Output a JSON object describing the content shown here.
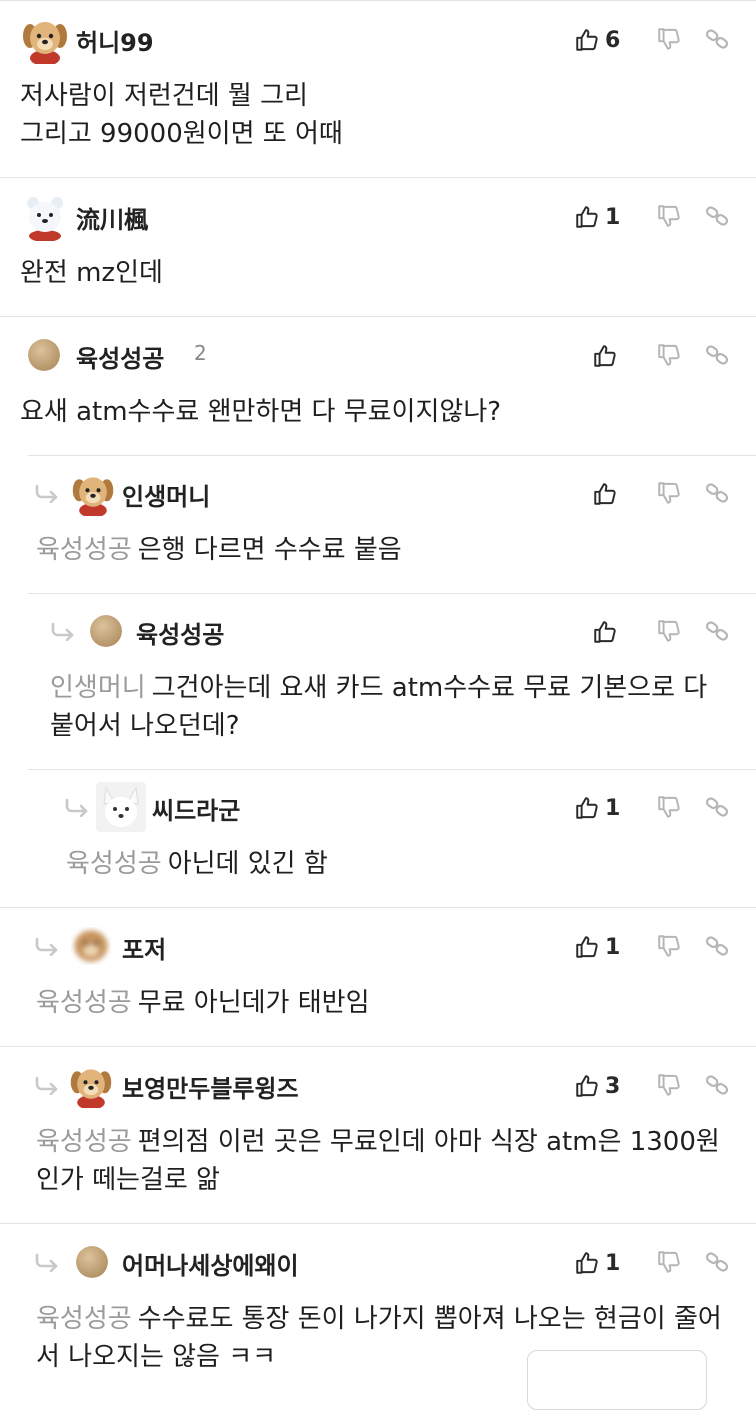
{
  "comments": [
    {
      "depth": 0,
      "nickname": "허니99",
      "avatar": "golden-puppy-avatar",
      "likes": "6",
      "mention": "",
      "text": "저사람이 저런건데 뭘 그리\n그리고 99000원이면 또 어때"
    },
    {
      "depth": 0,
      "nickname": "流川楓",
      "avatar": "white-puppy-avatar",
      "likes": "1",
      "mention": "",
      "text": "완전 mz인데"
    },
    {
      "depth": 0,
      "nickname": "육성성공",
      "avatar": "default-circle-avatar",
      "extra": "2",
      "likes": "",
      "mention": "",
      "text": "요새 atm수수료 왠만하면 다 무료이지않나?"
    },
    {
      "depth": 1,
      "nickname": "인생머니",
      "avatar": "golden-puppy-avatar",
      "likes": "",
      "mention": "육성성공",
      "text": "은행 다르면 수수료 붙음"
    },
    {
      "depth": 2,
      "nickname": "육성성공",
      "avatar": "default-circle-avatar",
      "likes": "",
      "mention": "인생머니",
      "text": "그건아는데 요새 카드 atm수수료 무료 기본으로 다 붙어서 나오던데?"
    },
    {
      "depth": 3,
      "nickname": "씨드라군",
      "avatar": "white-dog-avatar",
      "likes": "1",
      "mention": "육성성공",
      "text": "아닌데 있긴 함"
    },
    {
      "depth": 1,
      "nickname": "포저",
      "avatar": "blurred-puppy-avatar",
      "likes": "1",
      "mention": "육성성공",
      "text": "무료 아닌데가 태반임"
    },
    {
      "depth": 1,
      "nickname": "보영만두블루윙즈",
      "avatar": "golden-puppy-avatar",
      "likes": "3",
      "mention": "육성성공",
      "text": "편의점 이런 곳은 무료인데 아마 식장 atm은 1300원인가 떼는걸로 앎"
    },
    {
      "depth": 1,
      "nickname": "어머나세상에왜이",
      "avatar": "default-circle-avatar",
      "likes": "1",
      "mention": "육성성공",
      "text": "수수료도 통장 돈이 나가지 뽑아져 나오는 현금이 줄어서 나오지는 않음 ㅋㅋ"
    }
  ],
  "icons": {
    "like": "thumbs-up-icon",
    "dislike": "thumbs-down-icon",
    "link": "link-icon",
    "reply": "reply-arrow-icon"
  },
  "colors": {
    "mention": "#9b9b9b",
    "divider": "#e4e4e4",
    "icon": "#2a2a2a",
    "icon_muted": "#b5b5b5",
    "default_avatar": "#c8a97e"
  }
}
